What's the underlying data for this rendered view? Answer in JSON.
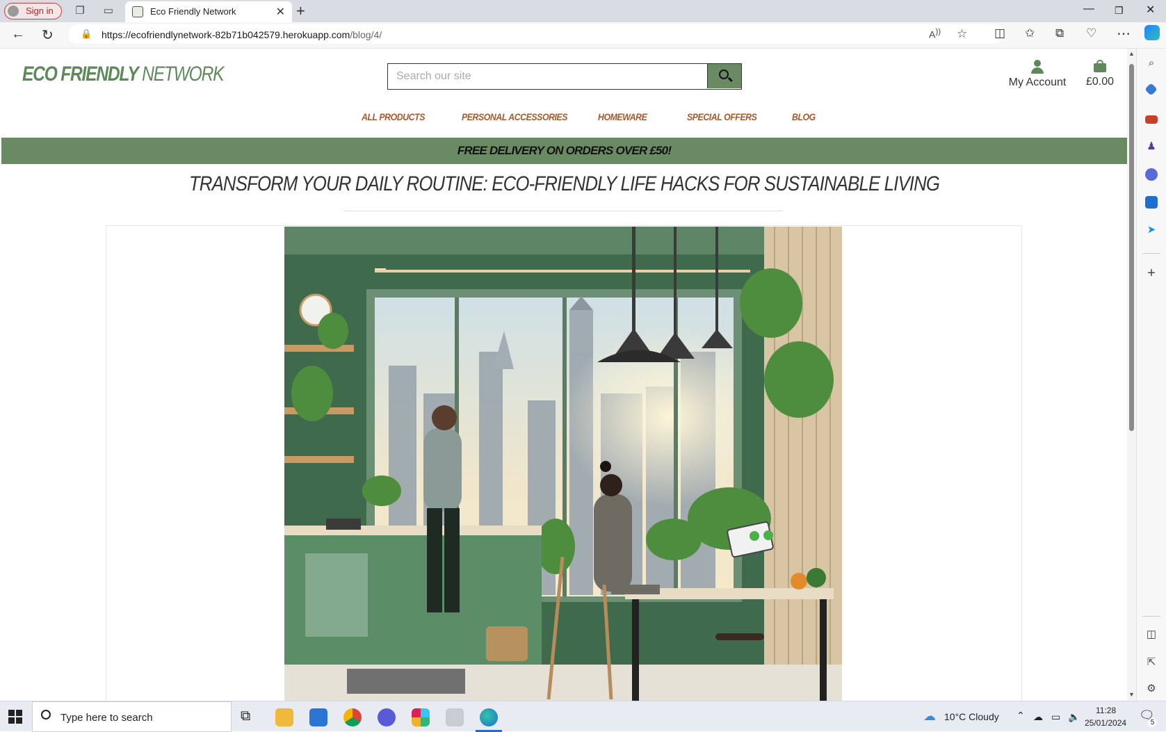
{
  "browser": {
    "sign_in": "Sign in",
    "tab_title": "Eco Friendly Network",
    "url_host": "https://ecofriendlynetwork-82b71b042579.herokuapp.com",
    "url_path": "/blog/4/"
  },
  "site": {
    "logo_bold": "ECO FRIENDLY",
    "logo_light": " NETWORK",
    "search_placeholder": "Search our site",
    "account_label": "My Account",
    "cart_total": "£0.00",
    "nav": [
      "ALL PRODUCTS",
      "PERSONAL ACCESSORIES",
      "HOMEWARE",
      "SPECIAL OFFERS",
      "BLOG"
    ],
    "banner": "FREE DELIVERY ON ORDERS OVER £50!",
    "post_title": "TRANSFORM YOUR DAILY ROUTINE:  ECO-FRIENDLY LIFE HACKS FOR SUSTAINABLE LIVING",
    "accent": "#6a8a63",
    "nav_color": "#a8582a"
  },
  "taskbar": {
    "search_placeholder": "Type here to search",
    "weather": "10°C  Cloudy",
    "time": "11:28",
    "date": "25/01/2024",
    "notif_count": "5"
  }
}
